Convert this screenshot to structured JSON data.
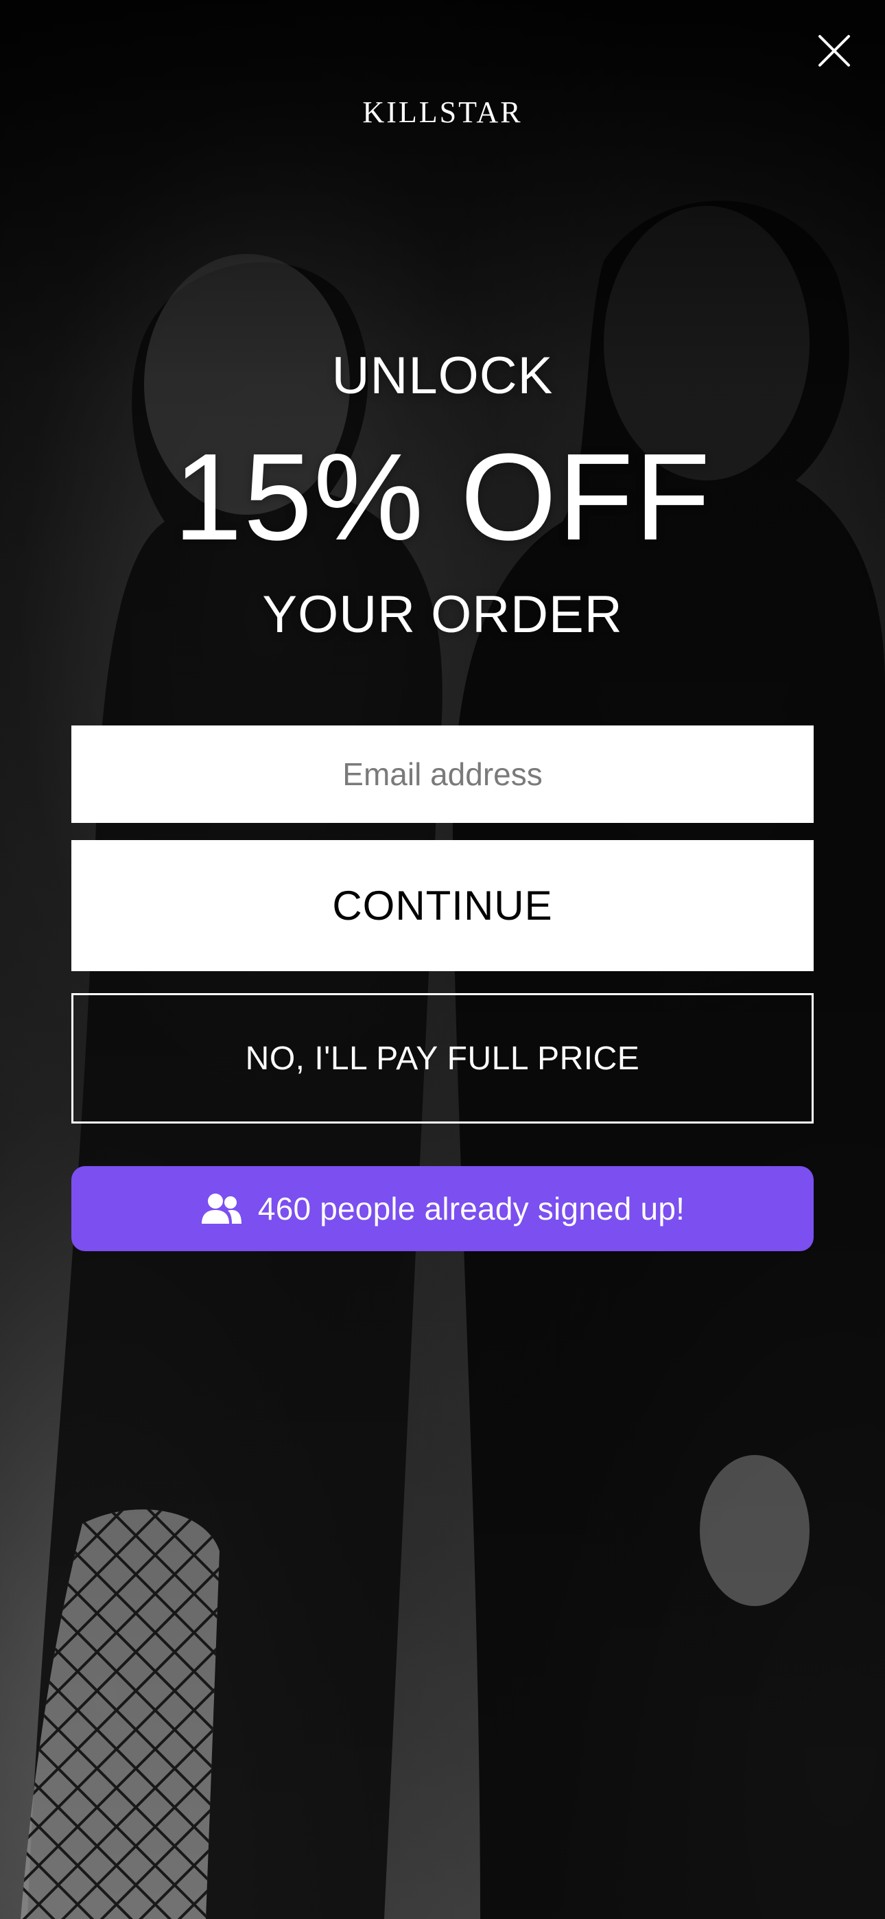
{
  "brand": {
    "logo_text": "KILLSTAR"
  },
  "headline": {
    "line1": "UNLOCK",
    "line2": "15% OFF",
    "line3": "YOUR ORDER"
  },
  "form": {
    "email_placeholder": "Email address",
    "email_value": "",
    "continue_label": "CONTINUE",
    "decline_label": "NO, I'LL PAY FULL PRICE"
  },
  "social_proof": {
    "text": "460 people already signed up!",
    "icon": "users-icon"
  },
  "icons": {
    "close": "close-icon"
  },
  "colors": {
    "accent": "#7b4ff0",
    "overlay": "#000000",
    "button_bg": "#ffffff",
    "button_text": "#000000"
  }
}
